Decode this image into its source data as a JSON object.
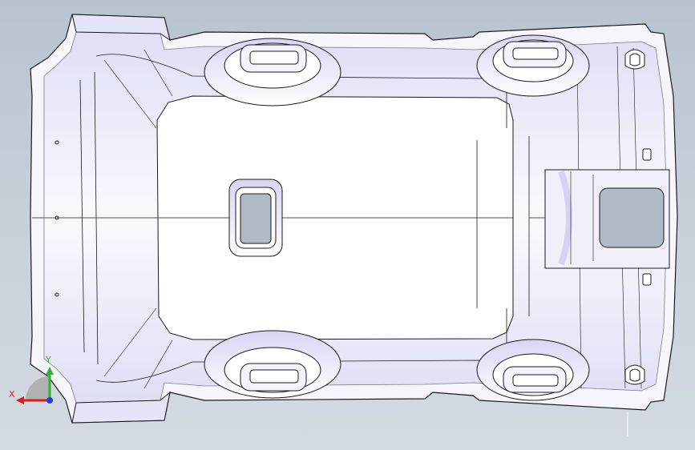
{
  "viewport": {
    "background_top": "#b9c3cf",
    "background_bottom": "#d3dae2"
  },
  "model": {
    "part": "headliner-panel",
    "view": "top",
    "display_style": "shaded-with-edges",
    "face_color": "#f4f3fb",
    "shade_color": "#c9c6ee",
    "edge_color": "#1a1a1a",
    "cutout_color": "#b0b9c6"
  },
  "triad": {
    "x_label": "X",
    "y_label": "Y",
    "x_color": "#e01b1b",
    "y_color": "#2bb52b",
    "z_color": "#1f3fd9"
  }
}
